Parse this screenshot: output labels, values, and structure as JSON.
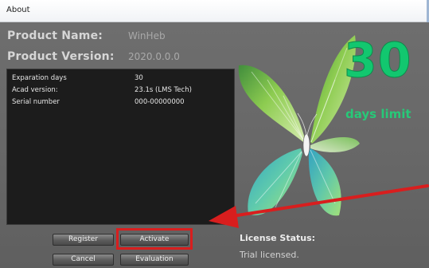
{
  "window": {
    "title": "About"
  },
  "product": {
    "name_label": "Product Name:",
    "name_value": "WinHeb",
    "version_label": "Product Version:",
    "version_value": "2020.0.0.0"
  },
  "details": {
    "rows": [
      {
        "key": "Exparation days",
        "value": "30"
      },
      {
        "key": "Acad version:",
        "value": "23.1s (LMS Tech)"
      },
      {
        "key": "Serial number",
        "value": "000-00000000"
      }
    ]
  },
  "buttons": {
    "register": "Register",
    "activate": "Activate",
    "cancel": "Cancel",
    "evaluation": "Evaluation"
  },
  "license": {
    "status_label": "License Status:",
    "status_value": "Trial licensed."
  },
  "trial": {
    "days": "30",
    "limit_text": "days limit"
  },
  "colors": {
    "accent_green": "#12c76f",
    "highlight_red": "#d81e1e",
    "panel_background": "#1c1c1c"
  },
  "icons": {
    "butterfly": "butterfly-logo",
    "annotation": "red-arrow"
  }
}
